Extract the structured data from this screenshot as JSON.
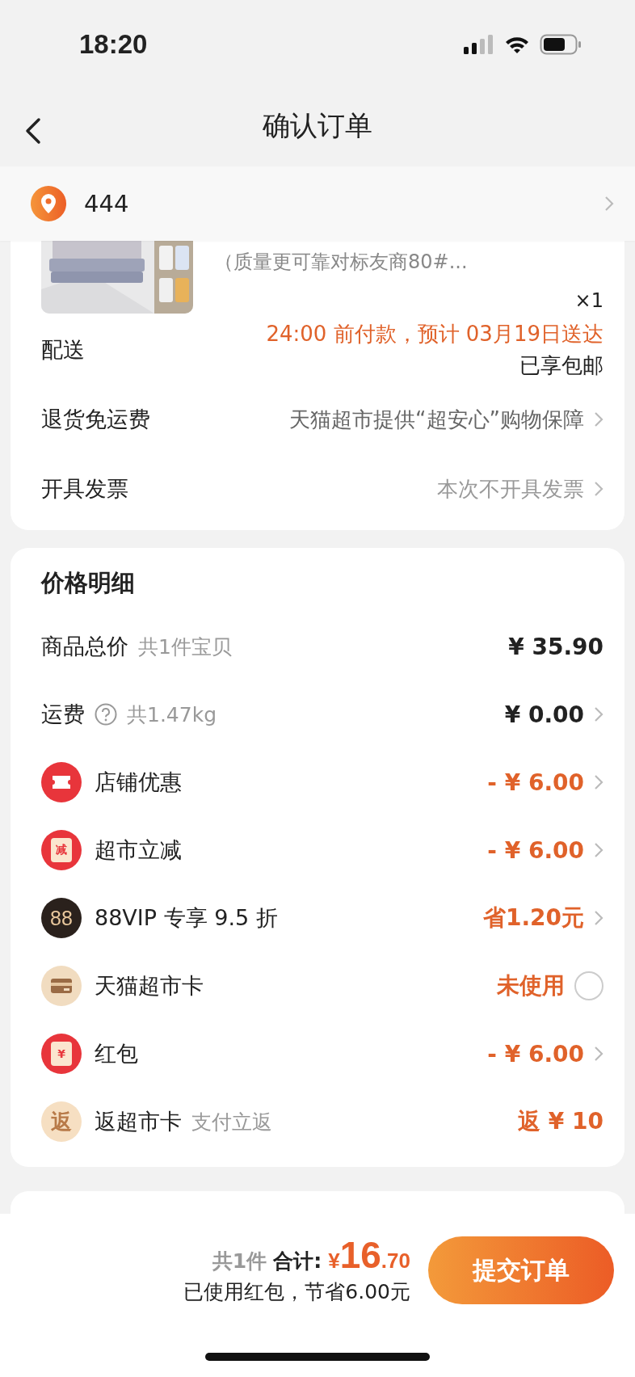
{
  "status_bar": {
    "time": "18:20"
  },
  "nav": {
    "title": "确认订单"
  },
  "address": {
    "text": "444"
  },
  "product": {
    "kind": "picture",
    "title_line": "（质量更可靠对标友商80#...",
    "quantity": "×1"
  },
  "order_rows": [
    {
      "label": "配送",
      "value": "24:00 前付款，预计 03月19日送达",
      "note": "已享包邮",
      "chevron": false,
      "color": "#e0622a"
    },
    {
      "label": "退货免运费",
      "value": "天猫超市提供“超安心”购物保障",
      "chevron": true,
      "color": "#666666"
    },
    {
      "label": "开具发票",
      "value": "本次不开具发票",
      "chevron": true,
      "color": "#999999"
    }
  ],
  "price_detail": {
    "title": "价格明细",
    "rows": [
      {
        "kind": "plain",
        "label": "商品总价",
        "sub": "共1件宝贝",
        "value": "¥ 35.90",
        "color": "#222222",
        "chevron": false
      },
      {
        "kind": "help",
        "label": "运费",
        "sub": "共1.47kg",
        "value": "¥ 0.00",
        "color": "#222222",
        "chevron": true
      },
      {
        "kind": "ticket",
        "label": "店铺优惠",
        "value": "- ¥ 6.00",
        "color": "#e0622a",
        "chevron": true
      },
      {
        "kind": "discount",
        "icon_text": "减",
        "label": "超市立减",
        "value": "- ¥ 6.00",
        "color": "#e0622a",
        "chevron": true
      },
      {
        "kind": "vip",
        "icon_text": "88",
        "label": "88VIP 专享 9.5 折",
        "value": "省1.20元",
        "color": "#e0622a",
        "chevron": true
      },
      {
        "kind": "card",
        "label": "天猫超市卡",
        "value": "未使用",
        "color": "#e0622a",
        "chevron": false,
        "selected": false
      },
      {
        "kind": "redpacket",
        "icon_text": "¥",
        "label": "红包",
        "value": "- ¥ 6.00",
        "color": "#e0622a",
        "chevron": true
      },
      {
        "kind": "rebate",
        "icon_text": "返",
        "label": "返超市卡",
        "sub": "支付立返",
        "value": "返 ¥ 10",
        "color": "#e0622a",
        "chevron": false
      }
    ]
  },
  "footer": {
    "count": "共1件",
    "total_label": "合计:",
    "currency": "¥",
    "total_int": "16",
    "total_dec": ".70",
    "savings": "已使用红包，节省6.00元",
    "submit": "提交订单"
  }
}
